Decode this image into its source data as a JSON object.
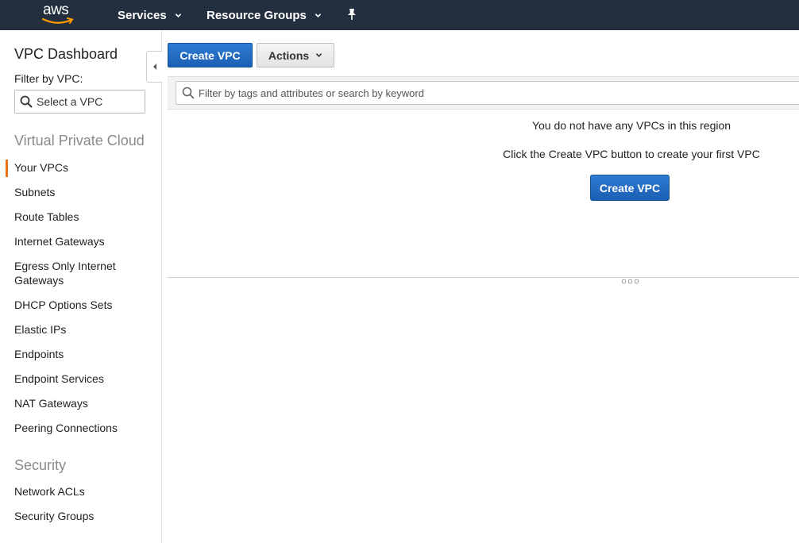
{
  "topnav": {
    "logo_text": "aws",
    "services_label": "Services",
    "resource_groups_label": "Resource Groups",
    "bg_color": "#232f3e",
    "icons": {
      "caret": "chevron-down-icon",
      "pin": "pin-icon"
    }
  },
  "sidebar": {
    "title": "VPC Dashboard",
    "filter_label": "Filter by VPC:",
    "select_placeholder": "Select a VPC",
    "section_vpc": "Virtual Private Cloud",
    "vpc_items": [
      {
        "label": "Your VPCs",
        "active": true
      },
      {
        "label": "Subnets"
      },
      {
        "label": "Route Tables"
      },
      {
        "label": "Internet Gateways"
      },
      {
        "label": "Egress Only Internet Gateways"
      },
      {
        "label": "DHCP Options Sets"
      },
      {
        "label": "Elastic IPs"
      },
      {
        "label": "Endpoints"
      },
      {
        "label": "Endpoint Services"
      },
      {
        "label": "NAT Gateways"
      },
      {
        "label": "Peering Connections"
      }
    ],
    "section_security": "Security",
    "security_items": [
      {
        "label": "Network ACLs"
      },
      {
        "label": "Security Groups"
      }
    ],
    "active_color": "#ec7211"
  },
  "toolbar": {
    "create_label": "Create VPC",
    "actions_label": "Actions"
  },
  "search": {
    "placeholder": "Filter by tags and attributes or search by keyword"
  },
  "empty_state": {
    "message": "You do not have any VPCs in this region",
    "hint": "Click the Create VPC button to create your first VPC",
    "button_label": "Create VPC"
  },
  "colors": {
    "primary_button": "#1a5fb4"
  }
}
